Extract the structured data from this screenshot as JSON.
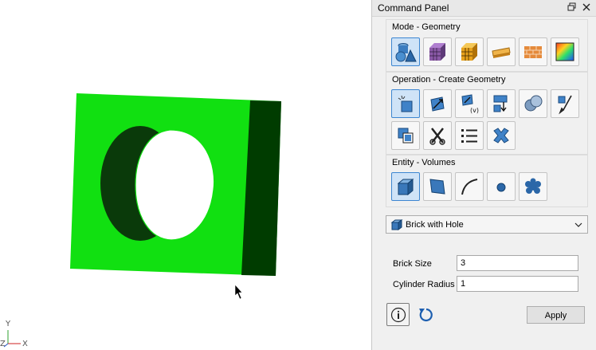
{
  "viewport": {
    "model_colors": {
      "face": "#11e011",
      "side": "#003c00",
      "hole_inner": "#0a3a0a"
    },
    "axis_labels": {
      "y": "Y",
      "x": "X",
      "z": "Z"
    }
  },
  "panel": {
    "title": "Command Panel",
    "title_icons": [
      "restore-icon",
      "close-icon"
    ],
    "mode_group": {
      "title": "Mode - Geometry",
      "buttons": [
        "geometry-mode-icon",
        "mesh-mode-icon",
        "hex-mesh-mode-icon",
        "boundary-conditions-icon",
        "materials-icon",
        "analysis-results-icon"
      ],
      "selected": 0
    },
    "operation_group": {
      "title": "Operation - Create Geometry",
      "buttons": [
        "create-geometry-icon",
        "transform-icon",
        "volume-operation-icon",
        "webcut-icon",
        "boolean-icon",
        "cleanup-icon",
        "copy-icon",
        "delete-icon",
        "list-icon",
        "remove-icon"
      ],
      "selected": 0
    },
    "entity_group": {
      "title": "Entity - Volumes",
      "buttons": [
        "volume-entity-icon",
        "surface-entity-icon",
        "curve-entity-icon",
        "vertex-entity-icon",
        "group-entity-icon"
      ],
      "selected": 0
    },
    "shape_select": {
      "value": "Brick with Hole",
      "icon": "brick-icon"
    },
    "fields": [
      {
        "label": "Brick Size",
        "value": "3"
      },
      {
        "label": "Cylinder Radius",
        "value": "1"
      }
    ],
    "apply_label": "Apply",
    "accent": "#3d86d1"
  }
}
